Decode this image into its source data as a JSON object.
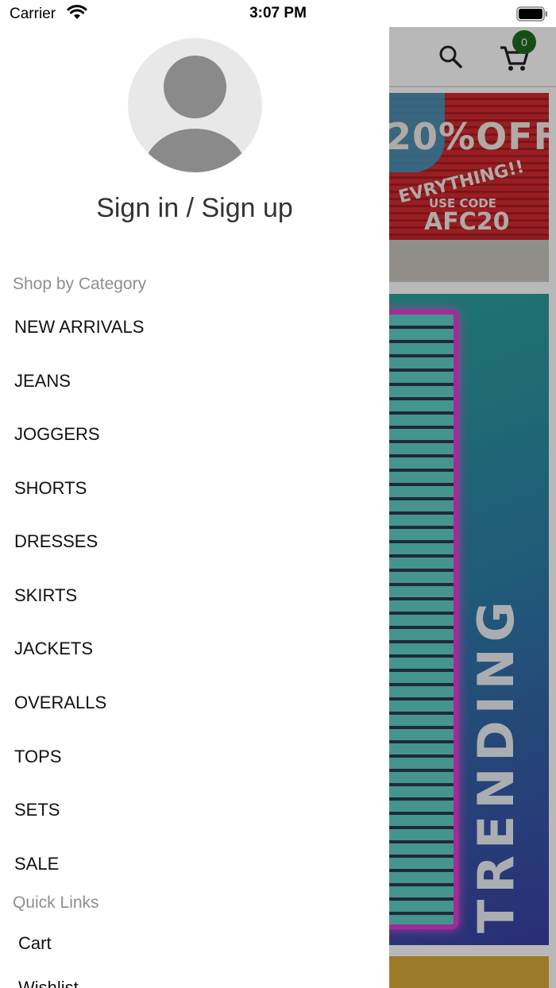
{
  "status_bar": {
    "carrier": "Carrier",
    "time": "3:07 PM"
  },
  "header": {
    "cart_count": "0"
  },
  "banners": {
    "sale": {
      "line1": "20%OFF",
      "line2": "EVRYTHING!!",
      "line3": "USE CODE",
      "code": "AFC20"
    },
    "trend": {
      "text": "TRENDING"
    }
  },
  "drawer": {
    "sign_in_label": "Sign in / Sign up",
    "category_title": "Shop by Category",
    "categories": [
      "NEW ARRIVALS",
      "JEANS",
      "JOGGERS",
      "SHORTS",
      "DRESSES",
      "SKIRTS",
      "JACKETS",
      "OVERALLS",
      "TOPS",
      "SETS",
      "SALE"
    ],
    "quick_links_title": "Quick Links",
    "quick_links": [
      "Cart",
      "Wishlist"
    ]
  },
  "colors": {
    "badge": "#1f6b1f",
    "section_title": "#8e8e8e",
    "overlay": "rgba(0,0,0,0.28)"
  }
}
